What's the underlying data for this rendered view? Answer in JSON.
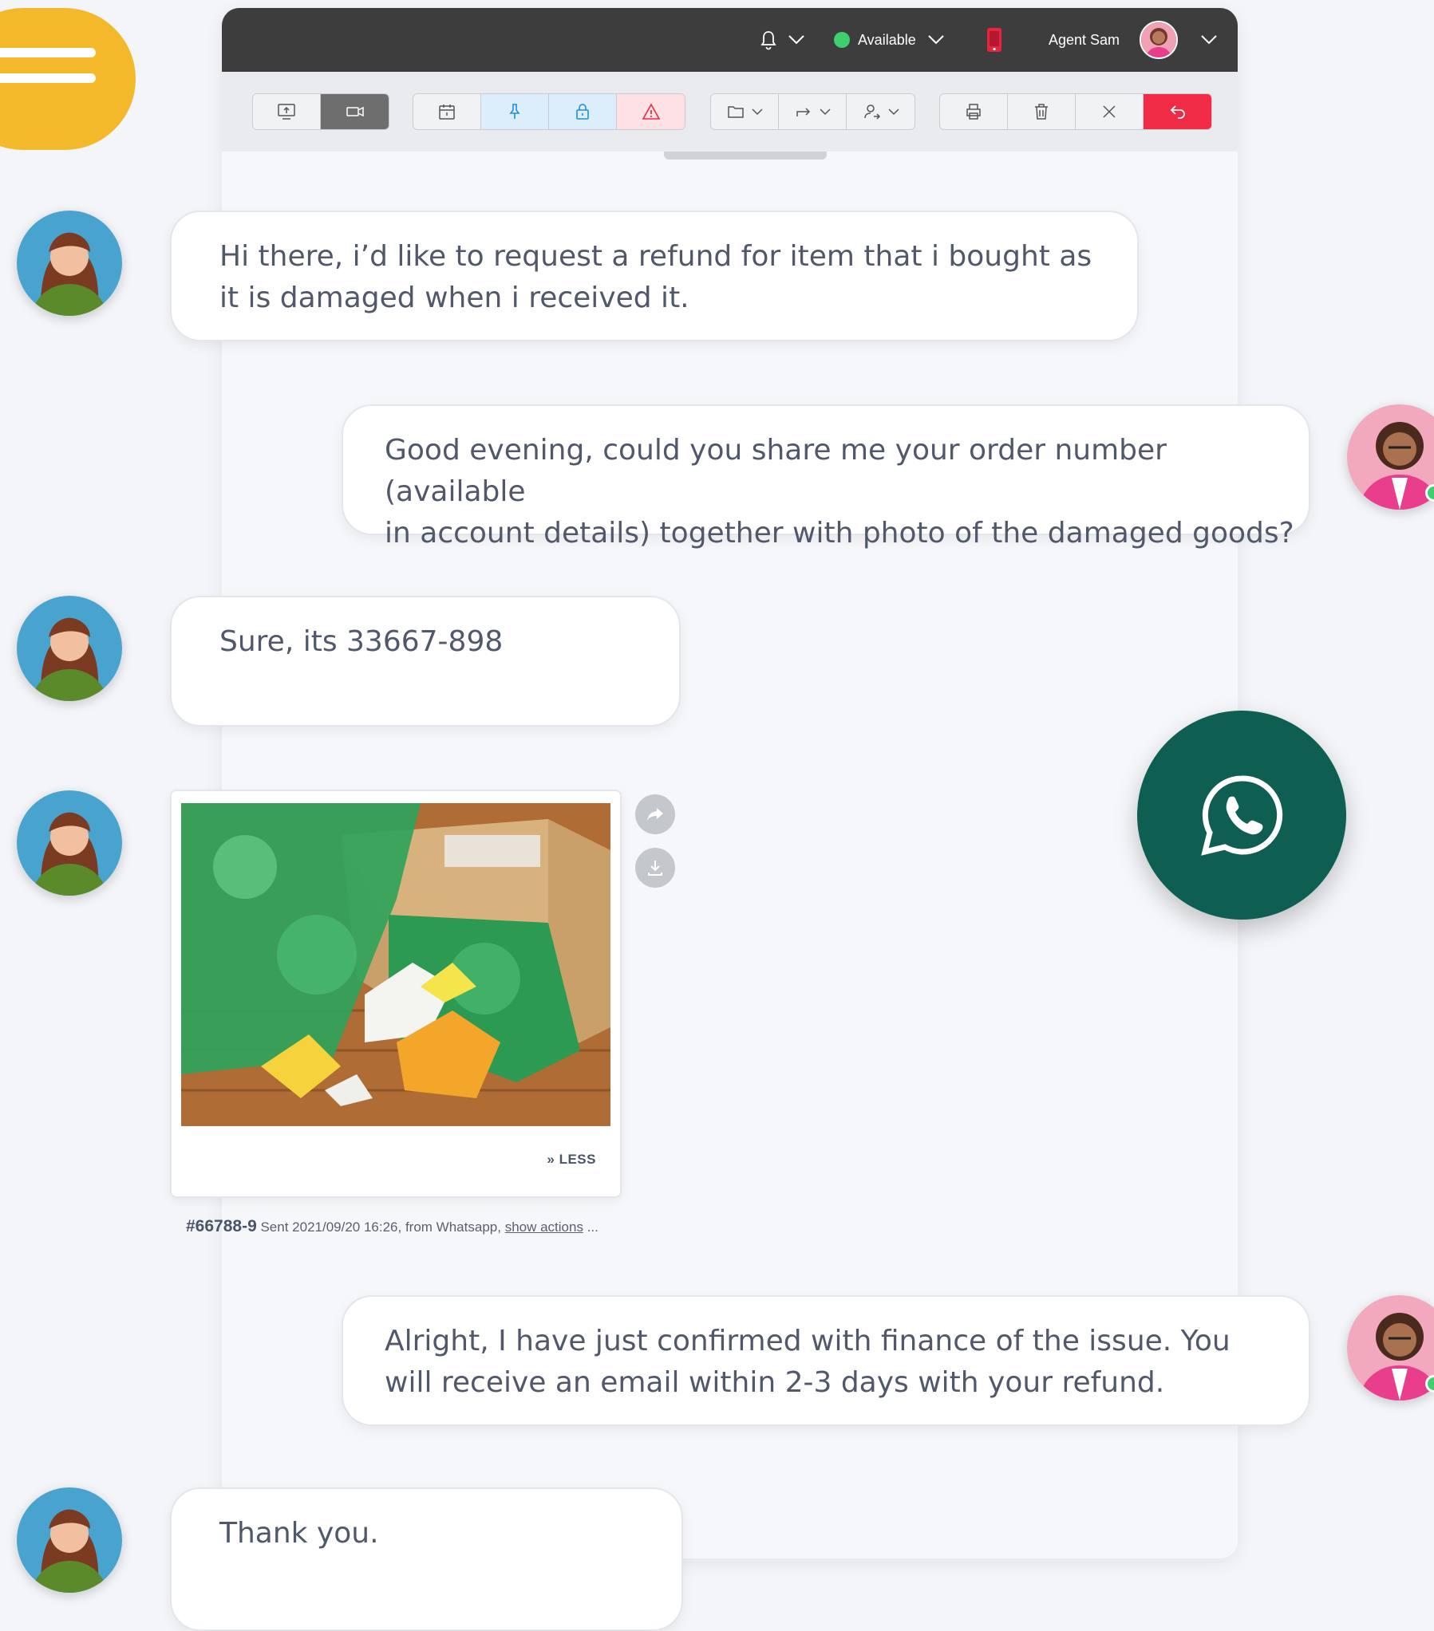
{
  "topbar": {
    "status": "Available",
    "status_color": "#3ecf6e",
    "agent_name": "Agent Sam",
    "icons": [
      "bell-icon",
      "chevron-down-icon",
      "mobile-phone-icon",
      "avatar",
      "chevron-down-icon"
    ]
  },
  "toolbar": {
    "groups": [
      [
        "screen-share-icon",
        "video-camera-icon"
      ],
      [
        "calendar-icon",
        "pin-icon",
        "lock-icon",
        "warning-icon"
      ],
      [
        "folder-icon",
        "forward-icon",
        "assign-user-icon"
      ],
      [
        "print-icon",
        "trash-icon",
        "close-icon",
        "undo-icon"
      ]
    ],
    "accent_red": "#ef2b45",
    "accent_blue": "#1f90d6"
  },
  "messages": [
    {
      "sender": "customer",
      "text_line1": "Hi there, i’d like to request a refund for item that i bought as",
      "text_line2": "it is damaged when i received it."
    },
    {
      "sender": "agent",
      "text_line1": "Good evening, could you share me your order number (available",
      "text_line2": "in account details) together with photo of the damaged goods?"
    },
    {
      "sender": "customer",
      "text_line1": "Sure, its 33667-898"
    },
    {
      "sender": "agent",
      "text_line1": "Alright, I have just confirmed with finance of the issue. You",
      "text_line2": "will receive an email within 2-3 days with your refund."
    },
    {
      "sender": "customer",
      "text_line1": "Thank you."
    }
  ],
  "image_message": {
    "less_label": "» LESS",
    "meta_number": "#66788-9",
    "meta_text": " Sent 2021/09/20 16:26, from Whatsapp, ",
    "meta_link": "show actions",
    "meta_ellipsis": " ..."
  },
  "whatsapp": {
    "brand_color": "#0e5f52",
    "icon": "whatsapp-icon"
  }
}
